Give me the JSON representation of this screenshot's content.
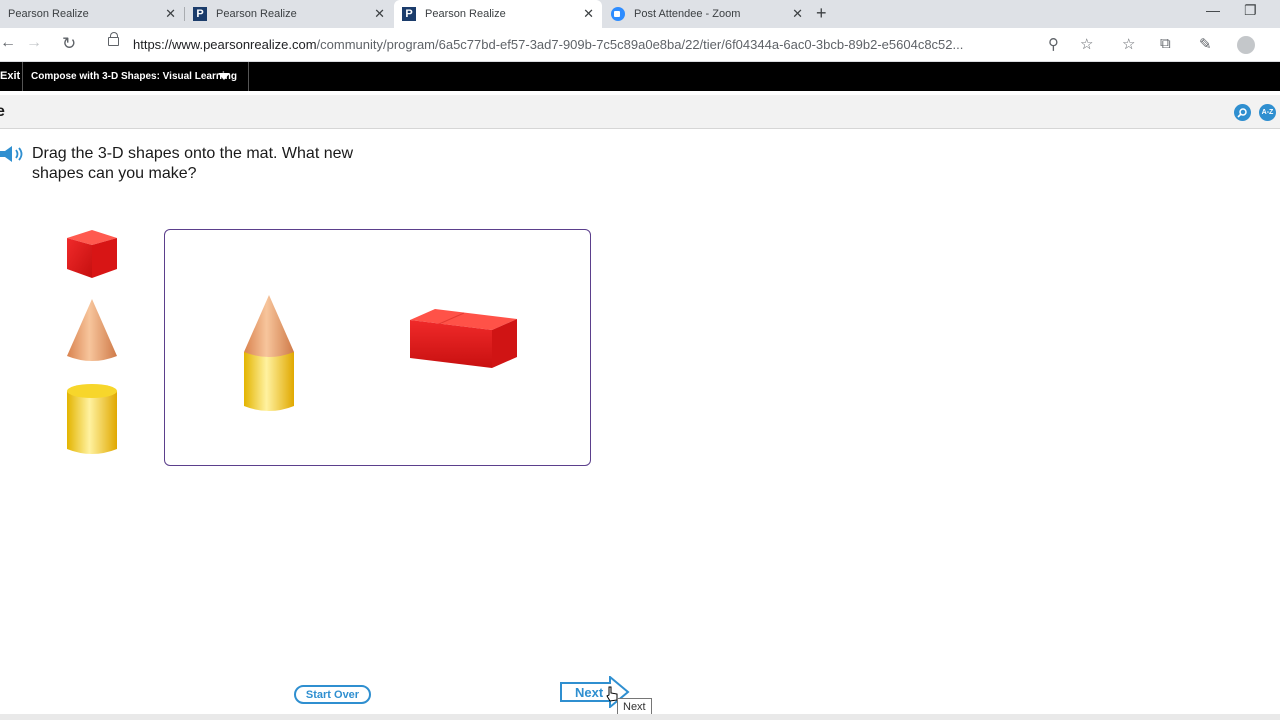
{
  "browser": {
    "tabs": [
      {
        "label": "Pearson Realize",
        "favicon": "none",
        "active": false
      },
      {
        "label": "Pearson Realize",
        "favicon": "pearson-icon",
        "active": false
      },
      {
        "label": "Pearson Realize",
        "favicon": "pearson-icon",
        "active": true
      },
      {
        "label": "Post Attendee - Zoom",
        "favicon": "zoom-icon",
        "active": false
      }
    ],
    "close_glyph": "✕",
    "new_tab_glyph": "+",
    "url_host": "https://www.pearsonrealize.com",
    "url_rest": "/community/program/6a5c77bd-ef57-3ad7-909b-7c5c89a0e8ba/22/tier/6f04344a-6ac0-3bcb-89b2-e5604c8c52...",
    "favicon_letter": "P"
  },
  "app": {
    "exit_label": "Exit",
    "lesson_title": "Compose with 3-D Shapes: Visual Learning",
    "glossary_label": "A-Z"
  },
  "activity": {
    "question": "Drag the 3-D shapes onto the mat. What new shapes can you make?",
    "start_over_label": "Start Over",
    "next_label": "Next",
    "tooltip": "Next"
  },
  "colors": {
    "accent_blue": "#2f8fd0",
    "mat_border": "#5b3f8c",
    "cube_red": "#e31b1b",
    "cone_orange": "#e89a66",
    "cylinder_yellow": "#f5cf1a"
  }
}
